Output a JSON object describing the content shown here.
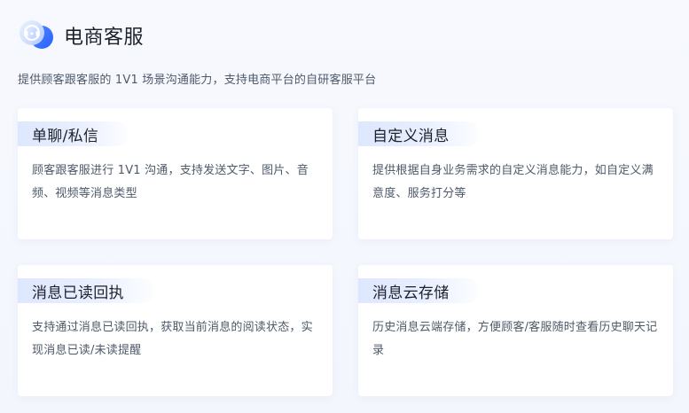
{
  "header": {
    "title": "电商客服",
    "icon": "customer-service-cloud-icon"
  },
  "subtitle": "提供顾客跟客服的 1V1 场景沟通能力，支持电商平台的自研客服平台",
  "features": [
    {
      "title": "单聊/私信",
      "description": "顾客跟客服进行 1V1 沟通，支持发送文字、图片、音频、视频等消息类型"
    },
    {
      "title": "自定义消息",
      "description": "提供根据自身业务需求的自定义消息能力，如自定义满意度、服务打分等"
    },
    {
      "title": "消息已读回执",
      "description": "支持通过消息已读回执，获取当前消息的阅读状态，实现消息已读/未读提醒"
    },
    {
      "title": "消息云存储",
      "description": "历史消息云端存储，方便顾客/客服随时查看历史聊天记录"
    }
  ],
  "colors": {
    "accent": "#2f6bff",
    "title_pill": "#dde7ff",
    "text_primary": "#1d2129",
    "text_secondary": "#4e5969"
  }
}
